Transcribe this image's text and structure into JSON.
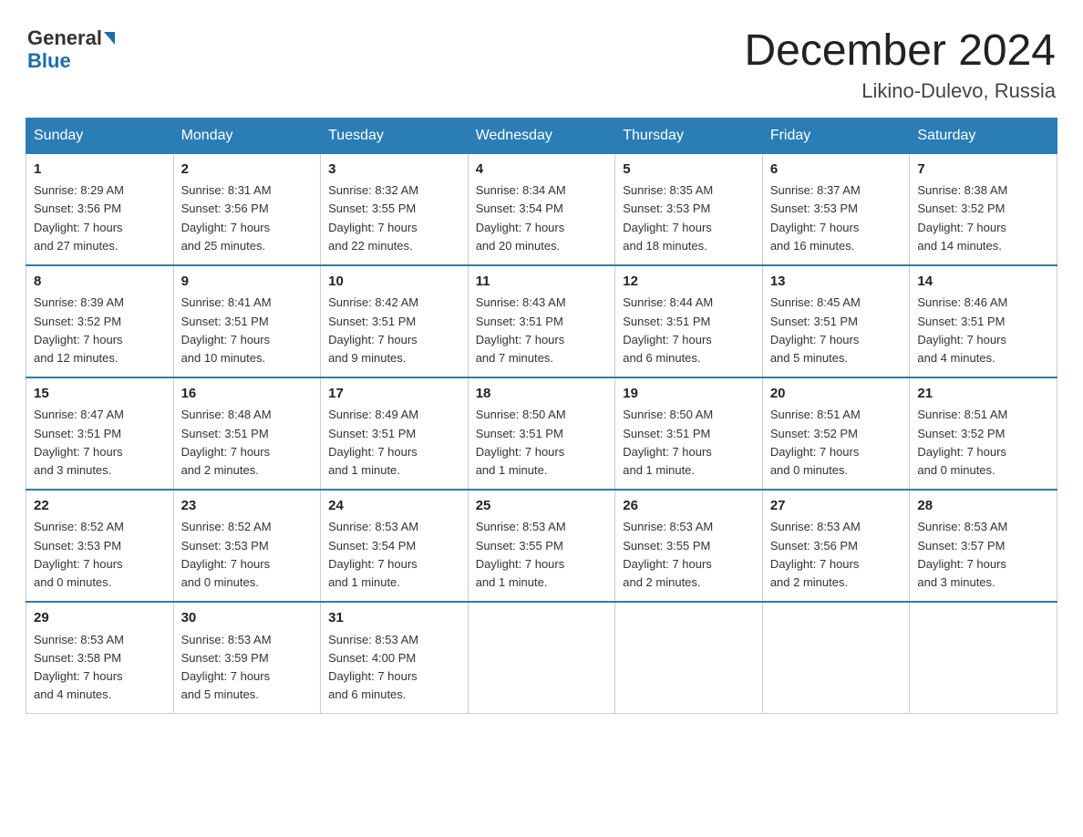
{
  "header": {
    "logo_general": "General",
    "logo_blue": "Blue",
    "title": "December 2024",
    "subtitle": "Likino-Dulevo, Russia"
  },
  "weekdays": [
    "Sunday",
    "Monday",
    "Tuesday",
    "Wednesday",
    "Thursday",
    "Friday",
    "Saturday"
  ],
  "weeks": [
    [
      {
        "day": "1",
        "sunrise": "8:29 AM",
        "sunset": "3:56 PM",
        "daylight": "7 hours and 27 minutes."
      },
      {
        "day": "2",
        "sunrise": "8:31 AM",
        "sunset": "3:56 PM",
        "daylight": "7 hours and 25 minutes."
      },
      {
        "day": "3",
        "sunrise": "8:32 AM",
        "sunset": "3:55 PM",
        "daylight": "7 hours and 22 minutes."
      },
      {
        "day": "4",
        "sunrise": "8:34 AM",
        "sunset": "3:54 PM",
        "daylight": "7 hours and 20 minutes."
      },
      {
        "day": "5",
        "sunrise": "8:35 AM",
        "sunset": "3:53 PM",
        "daylight": "7 hours and 18 minutes."
      },
      {
        "day": "6",
        "sunrise": "8:37 AM",
        "sunset": "3:53 PM",
        "daylight": "7 hours and 16 minutes."
      },
      {
        "day": "7",
        "sunrise": "8:38 AM",
        "sunset": "3:52 PM",
        "daylight": "7 hours and 14 minutes."
      }
    ],
    [
      {
        "day": "8",
        "sunrise": "8:39 AM",
        "sunset": "3:52 PM",
        "daylight": "7 hours and 12 minutes."
      },
      {
        "day": "9",
        "sunrise": "8:41 AM",
        "sunset": "3:51 PM",
        "daylight": "7 hours and 10 minutes."
      },
      {
        "day": "10",
        "sunrise": "8:42 AM",
        "sunset": "3:51 PM",
        "daylight": "7 hours and 9 minutes."
      },
      {
        "day": "11",
        "sunrise": "8:43 AM",
        "sunset": "3:51 PM",
        "daylight": "7 hours and 7 minutes."
      },
      {
        "day": "12",
        "sunrise": "8:44 AM",
        "sunset": "3:51 PM",
        "daylight": "7 hours and 6 minutes."
      },
      {
        "day": "13",
        "sunrise": "8:45 AM",
        "sunset": "3:51 PM",
        "daylight": "7 hours and 5 minutes."
      },
      {
        "day": "14",
        "sunrise": "8:46 AM",
        "sunset": "3:51 PM",
        "daylight": "7 hours and 4 minutes."
      }
    ],
    [
      {
        "day": "15",
        "sunrise": "8:47 AM",
        "sunset": "3:51 PM",
        "daylight": "7 hours and 3 minutes."
      },
      {
        "day": "16",
        "sunrise": "8:48 AM",
        "sunset": "3:51 PM",
        "daylight": "7 hours and 2 minutes."
      },
      {
        "day": "17",
        "sunrise": "8:49 AM",
        "sunset": "3:51 PM",
        "daylight": "7 hours and 1 minute."
      },
      {
        "day": "18",
        "sunrise": "8:50 AM",
        "sunset": "3:51 PM",
        "daylight": "7 hours and 1 minute."
      },
      {
        "day": "19",
        "sunrise": "8:50 AM",
        "sunset": "3:51 PM",
        "daylight": "7 hours and 1 minute."
      },
      {
        "day": "20",
        "sunrise": "8:51 AM",
        "sunset": "3:52 PM",
        "daylight": "7 hours and 0 minutes."
      },
      {
        "day": "21",
        "sunrise": "8:51 AM",
        "sunset": "3:52 PM",
        "daylight": "7 hours and 0 minutes."
      }
    ],
    [
      {
        "day": "22",
        "sunrise": "8:52 AM",
        "sunset": "3:53 PM",
        "daylight": "7 hours and 0 minutes."
      },
      {
        "day": "23",
        "sunrise": "8:52 AM",
        "sunset": "3:53 PM",
        "daylight": "7 hours and 0 minutes."
      },
      {
        "day": "24",
        "sunrise": "8:53 AM",
        "sunset": "3:54 PM",
        "daylight": "7 hours and 1 minute."
      },
      {
        "day": "25",
        "sunrise": "8:53 AM",
        "sunset": "3:55 PM",
        "daylight": "7 hours and 1 minute."
      },
      {
        "day": "26",
        "sunrise": "8:53 AM",
        "sunset": "3:55 PM",
        "daylight": "7 hours and 2 minutes."
      },
      {
        "day": "27",
        "sunrise": "8:53 AM",
        "sunset": "3:56 PM",
        "daylight": "7 hours and 2 minutes."
      },
      {
        "day": "28",
        "sunrise": "8:53 AM",
        "sunset": "3:57 PM",
        "daylight": "7 hours and 3 minutes."
      }
    ],
    [
      {
        "day": "29",
        "sunrise": "8:53 AM",
        "sunset": "3:58 PM",
        "daylight": "7 hours and 4 minutes."
      },
      {
        "day": "30",
        "sunrise": "8:53 AM",
        "sunset": "3:59 PM",
        "daylight": "7 hours and 5 minutes."
      },
      {
        "day": "31",
        "sunrise": "8:53 AM",
        "sunset": "4:00 PM",
        "daylight": "7 hours and 6 minutes."
      },
      null,
      null,
      null,
      null
    ]
  ],
  "labels": {
    "sunrise": "Sunrise:",
    "sunset": "Sunset:",
    "daylight": "Daylight:"
  }
}
